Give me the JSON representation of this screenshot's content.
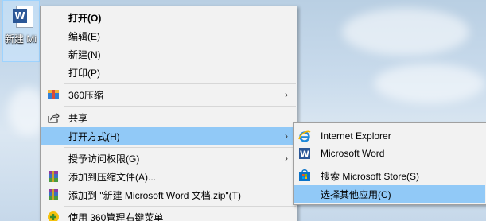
{
  "desktop_icon": {
    "caption": "新建 Microsoft Word 文档",
    "icon": "word-document-icon"
  },
  "context_menu": {
    "items": [
      {
        "label": "打开(O)",
        "bold": true
      },
      {
        "label": "编辑(E)"
      },
      {
        "label": "新建(N)"
      },
      {
        "label": "打印(P)"
      },
      {
        "label": "360压缩",
        "icon": "360-compress-icon",
        "submenu": true
      },
      {
        "label": "共享",
        "icon": "share-icon"
      },
      {
        "label": "打开方式(H)",
        "submenu": true,
        "highlighted": true
      },
      {
        "label": "授予访问权限(G)",
        "submenu": true
      },
      {
        "label": "添加到压缩文件(A)...",
        "icon": "winrar-icon"
      },
      {
        "label": "添加到 \"新建 Microsoft Word 文档.zip\"(T)",
        "icon": "winrar-icon"
      },
      {
        "label": "使用 360管理右键菜单",
        "icon": "360-manage-icon"
      }
    ],
    "submenu_arrow": "›"
  },
  "open_with_submenu": {
    "items": [
      {
        "label": "Internet Explorer",
        "icon": "internet-explorer-icon"
      },
      {
        "label": "Microsoft Word",
        "icon": "word-icon"
      },
      {
        "label": "搜索 Microsoft Store(S)",
        "icon": "microsoft-store-icon"
      },
      {
        "label": "选择其他应用(C)",
        "highlighted": true
      }
    ]
  },
  "colors": {
    "menu_bg": "#f2f2f2",
    "highlight": "#91c9f7",
    "word_blue": "#2b5797"
  }
}
